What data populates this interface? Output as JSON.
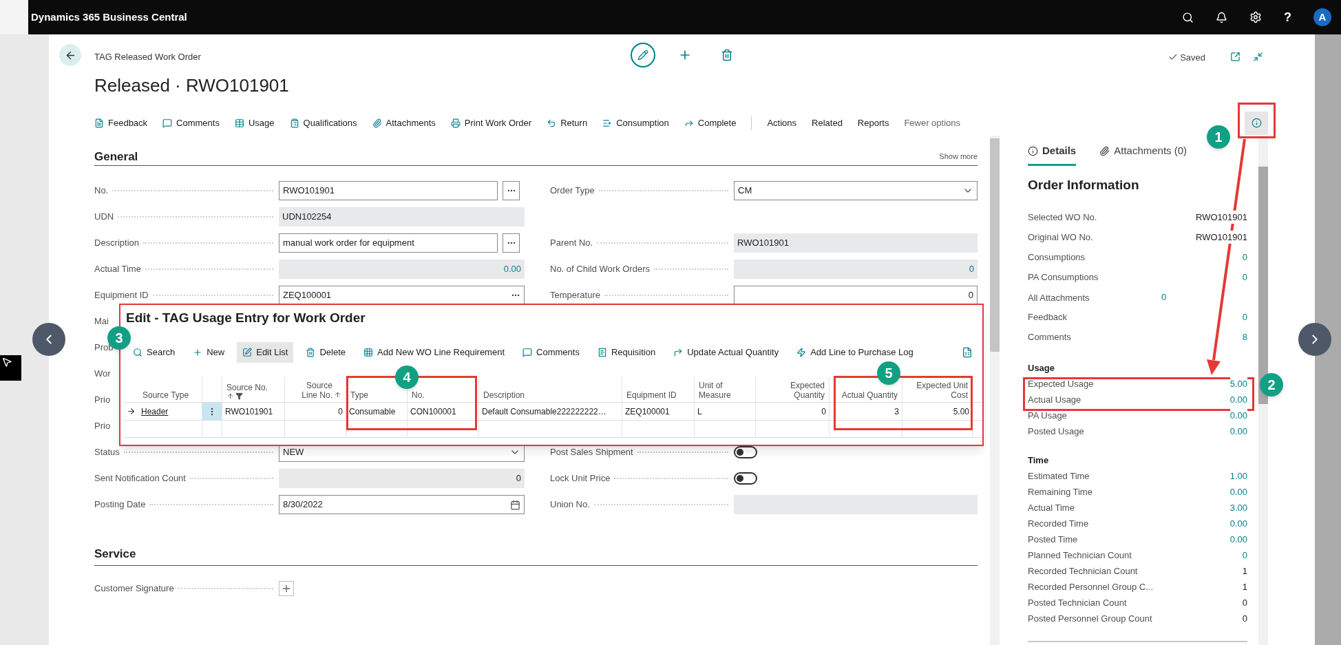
{
  "app_bar": {
    "title": "Dynamics 365 Business Central",
    "help": "?",
    "avatar": "A"
  },
  "page": {
    "caption": "TAG Released Work Order",
    "title": "Released · RWO101901",
    "status": "Saved"
  },
  "actions": [
    {
      "label": "Feedback"
    },
    {
      "label": "Comments"
    },
    {
      "label": "Usage"
    },
    {
      "label": "Qualifications"
    },
    {
      "label": "Attachments"
    },
    {
      "label": "Print Work Order"
    },
    {
      "label": "Return"
    },
    {
      "label": "Consumption"
    },
    {
      "label": "Complete"
    }
  ],
  "menus": [
    "Actions",
    "Related",
    "Reports",
    "Fewer options"
  ],
  "general": {
    "heading": "General",
    "show_more": "Show more",
    "rows": [
      {
        "left": {
          "label": "No.",
          "kind": "lookup",
          "value": "RWO101901",
          "link": false
        },
        "right": {
          "label": "Order Type",
          "kind": "select",
          "value": "CM",
          "link": false
        }
      },
      {
        "left": {
          "label": "UDN",
          "kind": "readonly",
          "value": "UDN102254",
          "link": false
        }
      },
      {
        "left": {
          "label": "Description",
          "kind": "lookup",
          "value": "manual work order for equipment",
          "link": false
        },
        "right": {
          "label": "Parent No.",
          "kind": "readonly",
          "value": "RWO101901",
          "link": false
        }
      },
      {
        "left": {
          "label": "Actual Time",
          "kind": "readonly_number",
          "value": "0.00",
          "link": true
        },
        "right": {
          "label": "No. of Child Work Orders",
          "kind": "readonly_number",
          "value": "0",
          "link": true
        }
      },
      {
        "left": {
          "label": "Equipment ID",
          "kind": "assist",
          "value": "ZEQ100001",
          "link": false
        },
        "right": {
          "label": "Temperature",
          "kind": "number",
          "value": "0",
          "link": false
        }
      },
      {
        "left": {
          "label": "Mai",
          "kind": "covered"
        }
      },
      {
        "left": {
          "label": "Prob",
          "kind": "covered"
        }
      },
      {
        "left": {
          "label": "Wor",
          "kind": "covered"
        }
      },
      {
        "left": {
          "label": "Prio",
          "kind": "covered"
        }
      },
      {
        "left": {
          "label": "Prio",
          "kind": "covered"
        }
      },
      {
        "left": {
          "label": "Status",
          "kind": "select",
          "value": "NEW",
          "link": false
        },
        "right": {
          "label": "Post Sales Shipment",
          "kind": "toggle",
          "on": false
        }
      },
      {
        "left": {
          "label": "Sent Notification Count",
          "kind": "readonly_number",
          "value": "0",
          "link": false
        },
        "right": {
          "label": "Lock Unit Price",
          "kind": "toggle",
          "on": false
        }
      },
      {
        "left": {
          "label": "Posting Date",
          "kind": "date",
          "value": "8/30/2022",
          "link": false
        },
        "right": {
          "label": "Union No.",
          "kind": "readonly"
        }
      }
    ]
  },
  "service": {
    "heading": "Service",
    "fields": [
      {
        "label": "Customer Signature",
        "kind": "add"
      }
    ]
  },
  "factbox": {
    "open": true,
    "tabs": [
      {
        "label": "Details",
        "selected": true
      },
      {
        "label": "Attachments (0)",
        "selected": false
      }
    ],
    "heading": "Order Information",
    "rows": [
      {
        "label": "Selected WO No.",
        "value": "RWO101901",
        "link": false,
        "kind": "field"
      },
      {
        "label": "Original WO No.",
        "value": "RWO101901",
        "link": false,
        "kind": "field"
      },
      {
        "label": "Consumptions",
        "value": "0",
        "link": true,
        "kind": "field"
      },
      {
        "label": "PA Consumptions",
        "value": "0",
        "link": true,
        "kind": "field"
      },
      {
        "label": "All Attachments",
        "value": "0",
        "link": true,
        "kind": "count"
      },
      {
        "label": "Feedback",
        "value": "0",
        "link": true,
        "kind": "field"
      },
      {
        "label": "Comments",
        "value": "8",
        "link": true,
        "kind": "field"
      }
    ],
    "sections": [
      {
        "heading": "Usage",
        "rows": [
          {
            "label": "Expected Usage",
            "value": "5.00",
            "link": true,
            "kind": "field"
          },
          {
            "label": "Actual Usage",
            "value": "0.00",
            "link": true,
            "kind": "field"
          },
          {
            "label": "PA Usage",
            "value": "0.00",
            "link": true,
            "kind": "field"
          },
          {
            "label": "Posted Usage",
            "value": "0.00",
            "link": true,
            "kind": "field"
          }
        ]
      },
      {
        "heading": "Time",
        "rows": [
          {
            "label": "Estimated Time",
            "value": "1.00",
            "link": true,
            "kind": "field"
          },
          {
            "label": "Remaining Time",
            "value": "0.00",
            "link": true,
            "kind": "field"
          },
          {
            "label": "Actual Time",
            "value": "3.00",
            "link": true,
            "kind": "field"
          },
          {
            "label": "Recorded Time",
            "value": "0.00",
            "link": true,
            "kind": "field"
          },
          {
            "label": "Posted Time",
            "value": "0.00",
            "link": true,
            "kind": "field"
          },
          {
            "label": "Planned Technician Count",
            "value": "0",
            "link": true,
            "kind": "field"
          },
          {
            "label": "Recorded Technician Count",
            "value": "1",
            "link": false,
            "kind": "field"
          },
          {
            "label": "Recorded Personnel Group C...",
            "value": "1",
            "link": false,
            "kind": "field"
          },
          {
            "label": "Posted Technician Count",
            "value": "0",
            "link": false,
            "kind": "field"
          },
          {
            "label": "Posted Personnel Group Count",
            "value": "0",
            "link": false,
            "kind": "field"
          }
        ]
      }
    ]
  },
  "dialog": {
    "title": "Edit - TAG Usage Entry for Work Order",
    "toolbar": [
      {
        "label": "Search",
        "selected": false
      },
      {
        "label": "New",
        "selected": false
      },
      {
        "label": "Edit List",
        "selected": true
      },
      {
        "label": "Delete",
        "selected": false
      },
      {
        "label": "Add New WO Line Requirement",
        "selected": false
      },
      {
        "label": "Comments",
        "selected": false
      },
      {
        "label": "Requisition",
        "selected": false
      },
      {
        "label": "Update Actual Quantity",
        "selected": false
      },
      {
        "label": "Add Line to Purchase Log",
        "selected": false
      }
    ],
    "columns": [
      {
        "label": "Source Type",
        "kind": "link",
        "sorted": false,
        "filtered": false
      },
      {
        "label": "Source No.",
        "kind": "text",
        "sorted": true,
        "filtered": true
      },
      {
        "label": "Source Line No.",
        "kind": "number",
        "sorted": true,
        "filtered": false
      },
      {
        "label": "Type",
        "kind": "text",
        "sorted": false,
        "filtered": false
      },
      {
        "label": "No.",
        "kind": "text",
        "sorted": false,
        "filtered": false
      },
      {
        "label": "Description",
        "kind": "text",
        "sorted": false,
        "filtered": false
      },
      {
        "label": "Equipment ID",
        "kind": "text",
        "sorted": false,
        "filtered": false
      },
      {
        "label": "Unit of Measure",
        "kind": "text",
        "sorted": false,
        "filtered": false
      },
      {
        "label": "Expected Quantity",
        "kind": "number",
        "sorted": false,
        "filtered": false
      },
      {
        "label": "Actual Quantity",
        "kind": "number",
        "sorted": false,
        "filtered": false
      },
      {
        "label": "Expected Unit Cost",
        "kind": "number",
        "sorted": false,
        "filtered": false
      }
    ],
    "rows": [
      {
        "current": true,
        "cells": [
          "Header",
          "RWO101901",
          "0",
          "Consumable",
          "CON100001",
          "Default Consumable222222222…",
          "ZEQ100001",
          "L",
          "0",
          "3",
          "5.00"
        ]
      }
    ]
  },
  "annotations": [
    {
      "number": "1"
    },
    {
      "number": "2"
    },
    {
      "number": "3"
    },
    {
      "number": "4"
    },
    {
      "number": "5"
    }
  ]
}
